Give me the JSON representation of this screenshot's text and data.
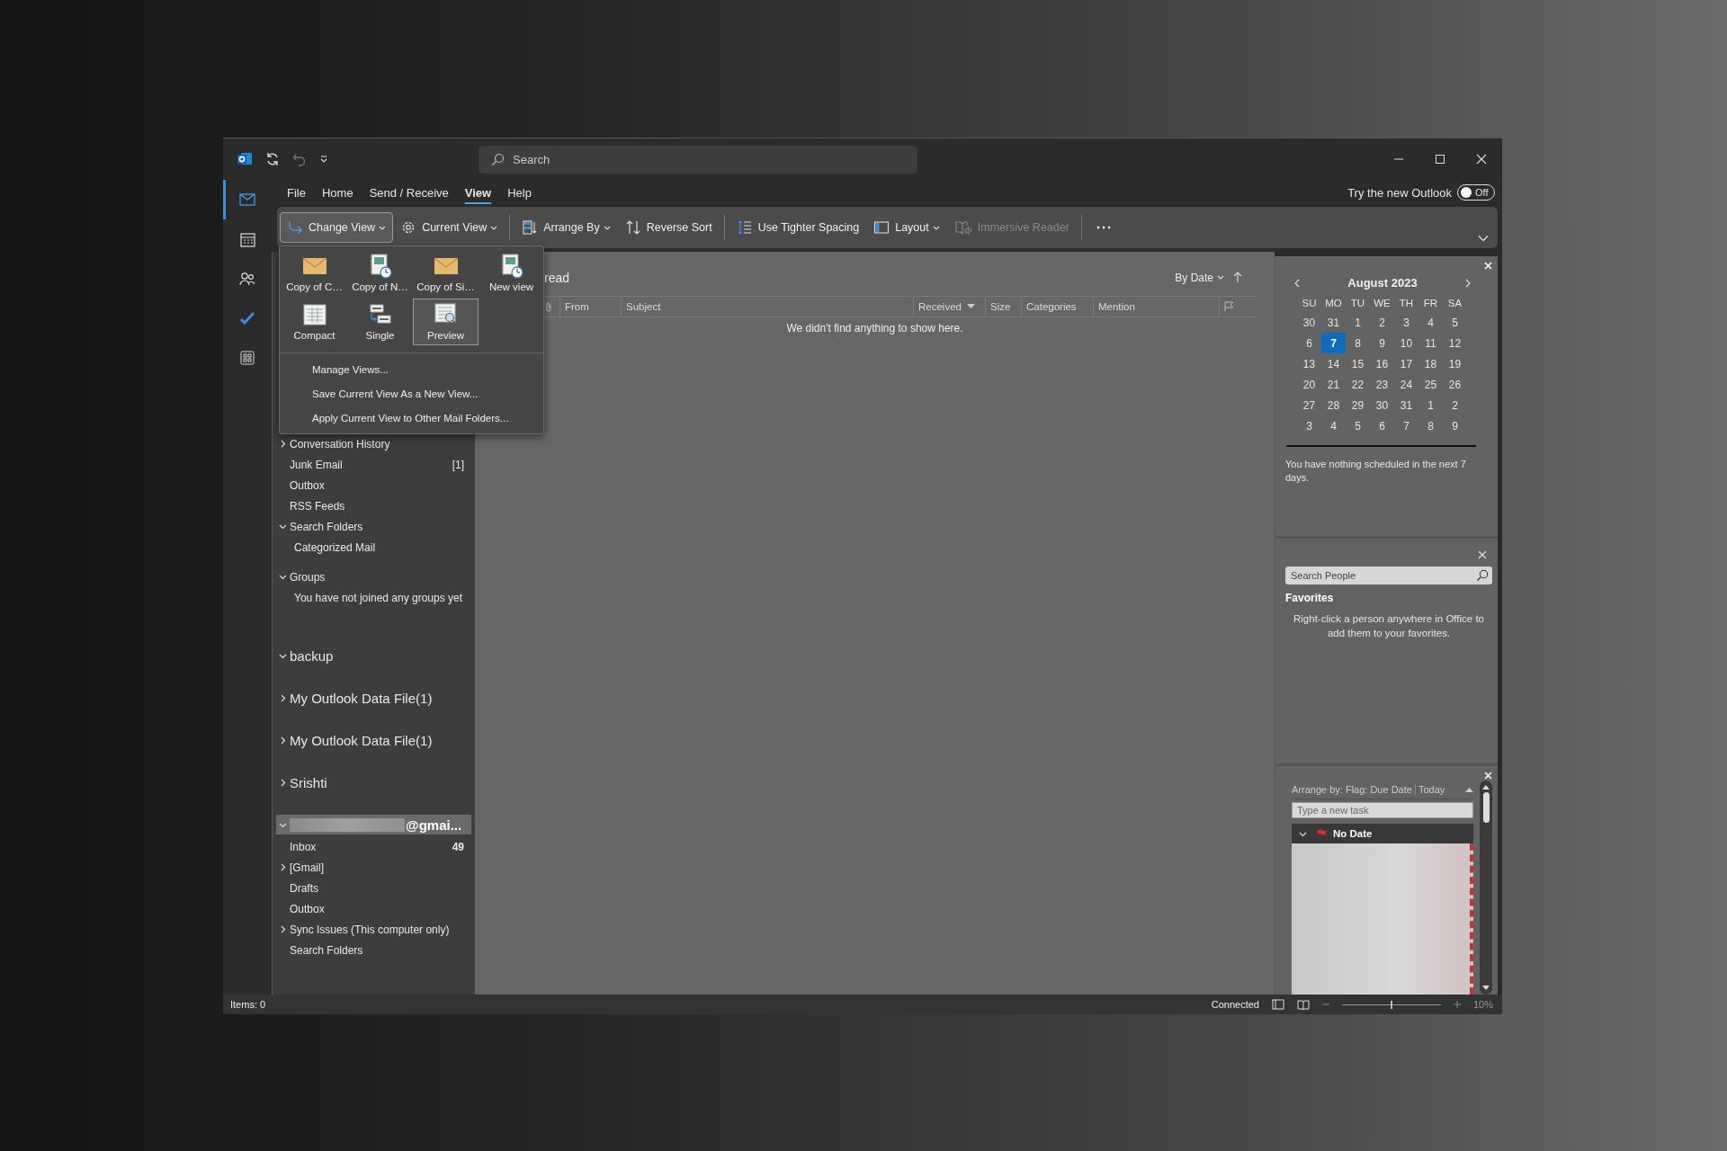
{
  "title_bar": {
    "search": {
      "placeholder": "Search"
    }
  },
  "nav_rail": [
    {
      "kind": "mail",
      "selected": true
    },
    {
      "kind": "calendar",
      "selected": false
    },
    {
      "kind": "people",
      "selected": false
    },
    {
      "kind": "tasks",
      "selected": false
    },
    {
      "kind": "apps",
      "selected": false
    }
  ],
  "menu": [
    {
      "label": "File",
      "selected": false
    },
    {
      "label": "Home",
      "selected": false
    },
    {
      "label": "Send / Receive",
      "selected": false
    },
    {
      "label": "View",
      "selected": true
    },
    {
      "label": "Help",
      "selected": false
    }
  ],
  "new_outlook": {
    "label": "Try the new Outlook",
    "toggle": "Off",
    "on": false
  },
  "ribbon": [
    {
      "kind": "change-view",
      "label": "Change View",
      "dropdown": true,
      "pressed": true,
      "disabled": false
    },
    {
      "kind": "current-view",
      "label": "Current View",
      "dropdown": true,
      "pressed": false,
      "disabled": false
    },
    {
      "kind": "separator"
    },
    {
      "kind": "arrange-by",
      "label": "Arrange By",
      "dropdown": true,
      "pressed": false,
      "disabled": false
    },
    {
      "kind": "reverse-sort",
      "label": "Reverse Sort",
      "dropdown": false,
      "pressed": false,
      "disabled": false
    },
    {
      "kind": "separator"
    },
    {
      "kind": "tighter-spacing",
      "label": "Use Tighter Spacing",
      "dropdown": false,
      "pressed": false,
      "disabled": false
    },
    {
      "kind": "layout",
      "label": "Layout",
      "dropdown": true,
      "pressed": false,
      "disabled": false
    },
    {
      "kind": "immersive-reader",
      "label": "Immersive Reader",
      "dropdown": false,
      "pressed": false,
      "disabled": true
    },
    {
      "kind": "separator"
    },
    {
      "kind": "more"
    }
  ],
  "change_view_menu": {
    "views": [
      {
        "label": "Copy of C…",
        "kind": "envelope",
        "selected": false
      },
      {
        "label": "Copy of N…",
        "kind": "notebook",
        "selected": false
      },
      {
        "label": "Copy of Si…",
        "kind": "envelope",
        "selected": false
      },
      {
        "label": "New view",
        "kind": "notebook",
        "selected": false
      },
      {
        "label": "Compact",
        "kind": "table",
        "selected": false
      },
      {
        "label": "Single",
        "kind": "single",
        "selected": false
      },
      {
        "label": "Preview",
        "kind": "preview",
        "selected": true
      }
    ],
    "commands": [
      "Manage Views...",
      "Save Current View As a New View...",
      "Apply Current View to Other Mail Folders..."
    ]
  },
  "folder_pane": {
    "folders": [
      {
        "label": "Conversation History",
        "kind": "folder",
        "expanded": false
      },
      {
        "label": "Junk Email",
        "kind": "folder",
        "count": "[1]"
      },
      {
        "label": "Outbox",
        "kind": "folder"
      },
      {
        "label": "RSS Feeds",
        "kind": "folder"
      },
      {
        "label": "Search Folders",
        "kind": "folder",
        "expanded": true,
        "children": [
          {
            "label": "Categorized Mail"
          }
        ]
      },
      {
        "label": "Groups",
        "kind": "section",
        "expanded": true,
        "children": [
          {
            "label": "You have not joined any groups yet"
          }
        ]
      }
    ],
    "accounts": [
      {
        "label": "backup",
        "expanded": true,
        "selected": false,
        "redacted": false
      },
      {
        "label": "My Outlook Data File(1)",
        "expanded": false,
        "selected": false,
        "redacted": false
      },
      {
        "label": "My Outlook Data File(1)",
        "expanded": false,
        "selected": false,
        "redacted": false
      },
      {
        "label": "Srishti",
        "expanded": false,
        "selected": false,
        "redacted": false
      },
      {
        "label": "@gmai...",
        "expanded": true,
        "selected": true,
        "redacted": true,
        "children": [
          {
            "label": "Inbox",
            "count": "49"
          },
          {
            "label": "[Gmail]",
            "expanded": false
          },
          {
            "label": "Drafts"
          },
          {
            "label": "Outbox"
          },
          {
            "label": "Sync Issues (This computer only)",
            "expanded": false
          },
          {
            "label": "Search Folders"
          }
        ]
      }
    ]
  },
  "message_list": {
    "filter": "read",
    "sort": "By Date",
    "columns": [
      {
        "kind": "attachment"
      },
      {
        "kind": "text",
        "label": "From",
        "sorted": false
      },
      {
        "kind": "text",
        "label": "Subject",
        "sorted": false
      },
      {
        "kind": "text",
        "label": "Received",
        "sorted": true
      },
      {
        "kind": "text",
        "label": "Size",
        "sorted": false
      },
      {
        "kind": "text",
        "label": "Categories",
        "sorted": false
      },
      {
        "kind": "text",
        "label": "Mention",
        "sorted": false
      },
      {
        "kind": "flag"
      }
    ],
    "empty_message": "We didn't find anything to show here."
  },
  "calendar": {
    "title": "August 2023",
    "weekdays": [
      "SU",
      "MO",
      "TU",
      "WE",
      "TH",
      "FR",
      "SA"
    ],
    "weeks": [
      [
        {
          "day": "30",
          "selected": false
        },
        {
          "day": "31",
          "selected": false
        },
        {
          "day": "1",
          "selected": false
        },
        {
          "day": "2",
          "selected": false
        },
        {
          "day": "3",
          "selected": false
        },
        {
          "day": "4",
          "selected": false
        },
        {
          "day": "5",
          "selected": false
        }
      ],
      [
        {
          "day": "6",
          "selected": false
        },
        {
          "day": "7",
          "selected": true
        },
        {
          "day": "8",
          "selected": false
        },
        {
          "day": "9",
          "selected": false
        },
        {
          "day": "10",
          "selected": false
        },
        {
          "day": "11",
          "selected": false
        },
        {
          "day": "12",
          "selected": false
        }
      ],
      [
        {
          "day": "13",
          "selected": false
        },
        {
          "day": "14",
          "selected": false
        },
        {
          "day": "15",
          "selected": false
        },
        {
          "day": "16",
          "selected": false
        },
        {
          "day": "17",
          "selected": false
        },
        {
          "day": "18",
          "selected": false
        },
        {
          "day": "19",
          "selected": false
        }
      ],
      [
        {
          "day": "20",
          "selected": false
        },
        {
          "day": "21",
          "selected": false
        },
        {
          "day": "22",
          "selected": false
        },
        {
          "day": "23",
          "selected": false
        },
        {
          "day": "24",
          "selected": false
        },
        {
          "day": "25",
          "selected": false
        },
        {
          "day": "26",
          "selected": false
        }
      ],
      [
        {
          "day": "27",
          "selected": false
        },
        {
          "day": "28",
          "selected": false
        },
        {
          "day": "29",
          "selected": false
        },
        {
          "day": "30",
          "selected": false
        },
        {
          "day": "31",
          "selected": false
        },
        {
          "day": "1",
          "selected": false
        },
        {
          "day": "2",
          "selected": false
        }
      ],
      [
        {
          "day": "3",
          "selected": false
        },
        {
          "day": "4",
          "selected": false
        },
        {
          "day": "5",
          "selected": false
        },
        {
          "day": "6",
          "selected": false
        },
        {
          "day": "7",
          "selected": false
        },
        {
          "day": "8",
          "selected": false
        },
        {
          "day": "9",
          "selected": false
        }
      ]
    ],
    "notice": "You have nothing scheduled in the next 7 days."
  },
  "people": {
    "search_placeholder": "Search People",
    "favorites_title": "Favorites",
    "hint": "Right-click a person anywhere in Office to add them to your favorites."
  },
  "tasks": {
    "arrange": "Arrange by: Flag: Due Date",
    "arrange_value": "Today",
    "new_task_placeholder": "Type a new task",
    "groups": [
      {
        "label": "No Date",
        "expanded": true
      }
    ]
  },
  "status_bar": {
    "items": "Items: 0",
    "connection": "Connected",
    "zoom": {
      "level": 0.5,
      "reading": "10%"
    }
  }
}
